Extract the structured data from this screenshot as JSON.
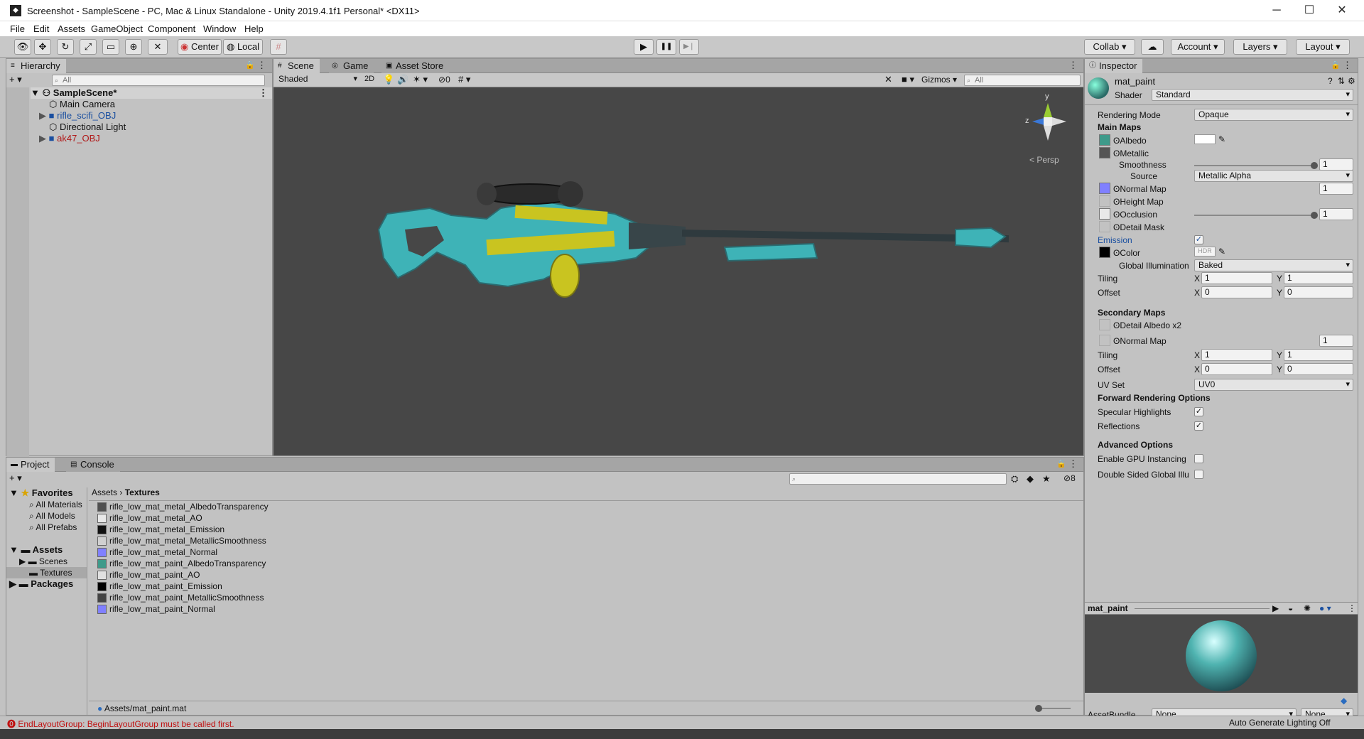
{
  "window": {
    "title": "Screenshot - SampleScene - PC, Mac & Linux Standalone - Unity 2019.4.1f1 Personal* <DX11>",
    "minimize": "─",
    "maximize": "☐",
    "close": "✕"
  },
  "menu": [
    "File",
    "Edit",
    "Assets",
    "GameObject",
    "Component",
    "Window",
    "Help"
  ],
  "toolbar": {
    "center": "Center",
    "local": "Local",
    "collab": "Collab",
    "account": "Account",
    "layers": "Layers",
    "layout": "Layout",
    "play": "▶",
    "pause": "❚❚",
    "step": "▶❘"
  },
  "hierarchy": {
    "tab": "Hierarchy",
    "add": "+ ▾",
    "search_placeholder": "All",
    "scene": "SampleScene*",
    "items": [
      {
        "label": "Main Camera",
        "color": "#111111"
      },
      {
        "label": "rifle_scifi_OBJ",
        "color": "#1a4fa0"
      },
      {
        "label": "Directional Light",
        "color": "#111111"
      },
      {
        "label": "ak47_OBJ",
        "color": "#b01818"
      }
    ]
  },
  "scene_view": {
    "tabs": [
      "Scene",
      "Game",
      "Asset Store"
    ],
    "shading": "Shaded",
    "mode2d": "2D",
    "hidden_count": "0",
    "gizmos": "Gizmos",
    "search_placeholder": "All",
    "gizmo": {
      "y": "y",
      "z": "z",
      "persp": "< Persp"
    },
    "background": "#474747"
  },
  "project": {
    "tabs": [
      "Project",
      "Console"
    ],
    "add": "+ ▾",
    "hidden_count": "8",
    "favorites": {
      "label": "Favorites",
      "items": [
        "All Materials",
        "All Models",
        "All Prefabs"
      ]
    },
    "assets": {
      "label": "Assets",
      "items": [
        "Scenes",
        "Textures"
      ]
    },
    "packages": "Packages",
    "breadcrumb": [
      "Assets",
      "Textures"
    ],
    "files": [
      {
        "name": "rifle_low_mat_metal_AlbedoTransparency",
        "color": "#505050"
      },
      {
        "name": "rifle_low_mat_metal_AO",
        "color": "#e8e8e8"
      },
      {
        "name": "rifle_low_mat_metal_Emission",
        "color": "#111111"
      },
      {
        "name": "rifle_low_mat_metal_MetallicSmoothness",
        "color": "#d0d0d0"
      },
      {
        "name": "rifle_low_mat_metal_Normal",
        "color": "#8080ff"
      },
      {
        "name": "rifle_low_mat_paint_AlbedoTransparency",
        "color": "#3e9a8a"
      },
      {
        "name": "rifle_low_mat_paint_AO",
        "color": "#e0e0e0"
      },
      {
        "name": "rifle_low_mat_paint_Emission",
        "color": "#000000"
      },
      {
        "name": "rifle_low_mat_paint_MetallicSmoothness",
        "color": "#444444"
      },
      {
        "name": "rifle_low_mat_paint_Normal",
        "color": "#8080ff"
      }
    ],
    "footer_path": "Assets/mat_paint.mat"
  },
  "inspector": {
    "tab": "Inspector",
    "material_name": "mat_paint",
    "shader_label": "Shader",
    "shader": "Standard",
    "rendering_mode_label": "Rendering Mode",
    "rendering_mode": "Opaque",
    "main_maps": "Main Maps",
    "albedo": "Albedo",
    "metallic": "Metallic",
    "smoothness_label": "Smoothness",
    "smoothness": "1",
    "source_label": "Source",
    "source": "Metallic Alpha",
    "normal_map": "Normal Map",
    "normal_value": "1",
    "height_map": "Height Map",
    "occlusion": "Occlusion",
    "occlusion_value": "1",
    "detail_mask": "Detail Mask",
    "emission": "Emission",
    "emission_checked": "✓",
    "color_label": "Color",
    "hdr": "HDR",
    "gi_label": "Global Illumination",
    "gi": "Baked",
    "tiling": "Tiling",
    "offset": "Offset",
    "x": "X",
    "y": "Y",
    "main_tiling": [
      "1",
      "1"
    ],
    "main_offset": [
      "0",
      "0"
    ],
    "secondary_maps": "Secondary Maps",
    "detail_albedo": "Detail Albedo x2",
    "sec_normal": "Normal Map",
    "sec_normal_value": "1",
    "sec_tiling": [
      "1",
      "1"
    ],
    "sec_offset": [
      "0",
      "0"
    ],
    "uv_set_label": "UV Set",
    "uv_set": "UV0",
    "forward": "Forward Rendering Options",
    "specular": "Specular Highlights",
    "specular_checked": "✓",
    "reflections": "Reflections",
    "reflections_checked": "✓",
    "advanced": "Advanced Options",
    "gpu_instancing": "Enable GPU Instancing",
    "double_sided": "Double Sided Global Illu",
    "preview_title": "mat_paint",
    "assetbundle_label": "AssetBundle",
    "assetbundle": "None",
    "assetbundle_variant": "None"
  },
  "status": {
    "error": "EndLayoutGroup: BeginLayoutGroup must be called first.",
    "right": "Auto Generate Lighting Off"
  }
}
